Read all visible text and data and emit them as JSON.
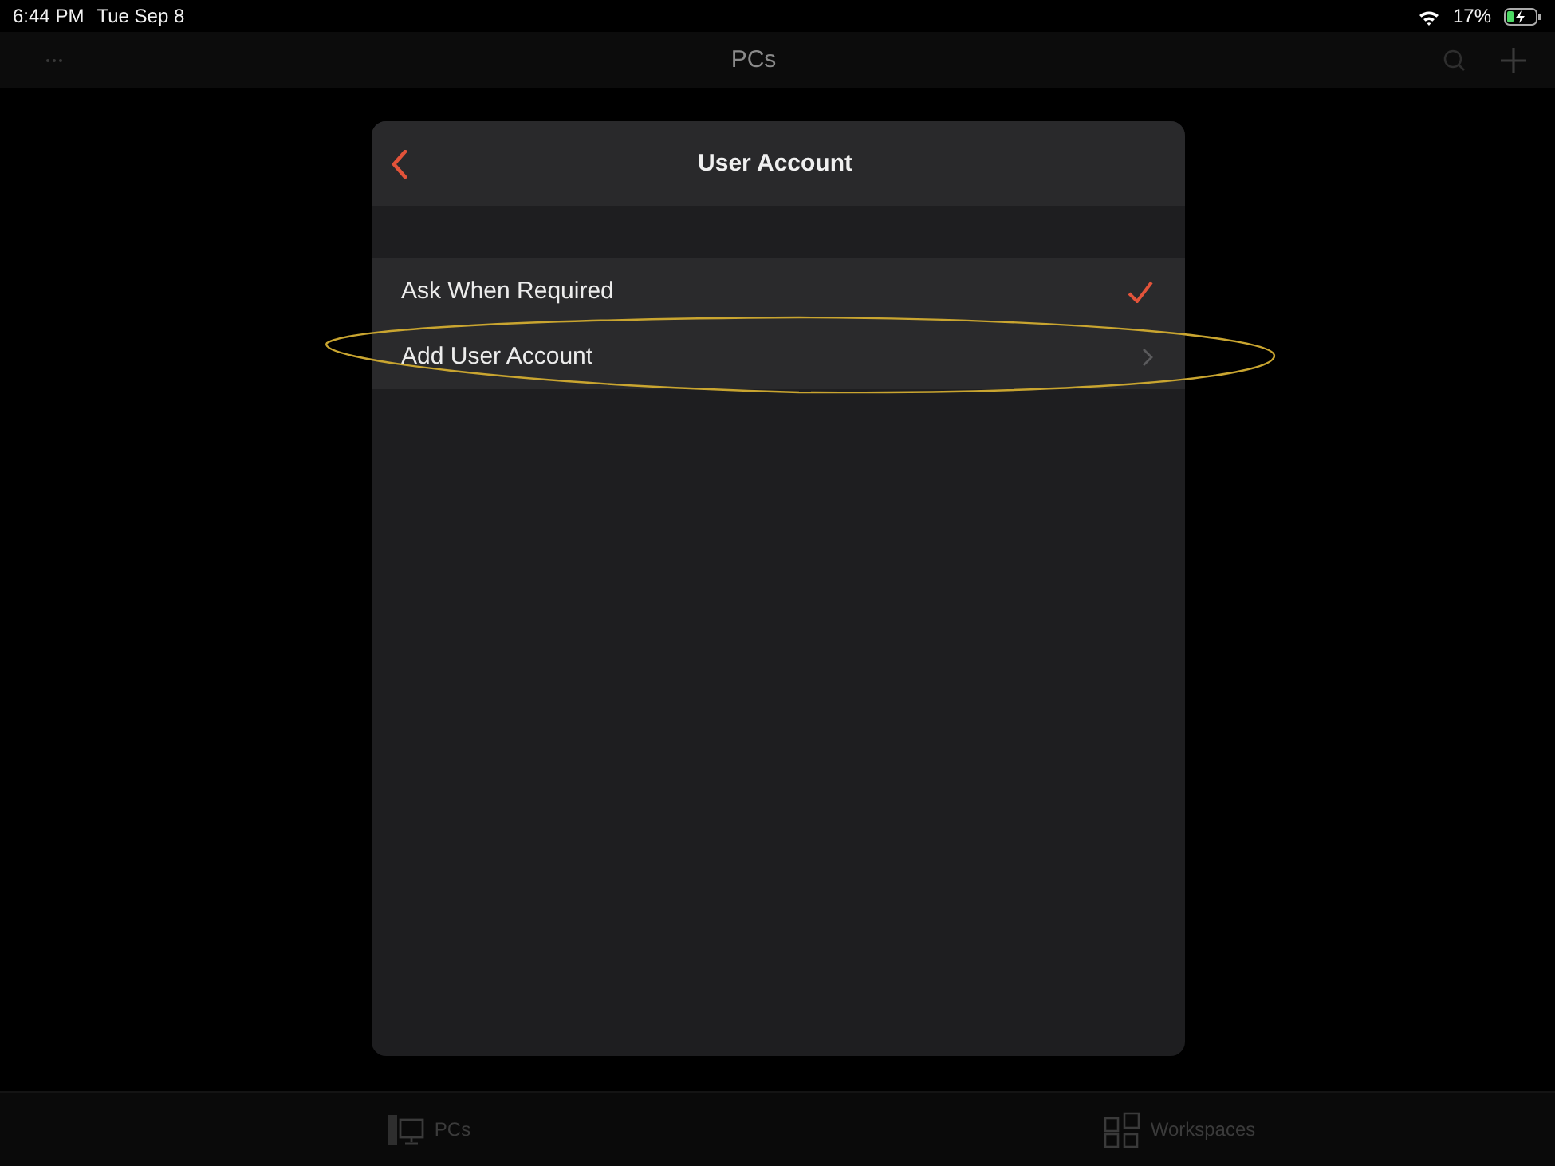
{
  "status_bar": {
    "time": "6:44 PM",
    "date": "Tue Sep 8",
    "battery": "17%",
    "charging": true
  },
  "nav_bar": {
    "title": "PCs"
  },
  "dialog": {
    "title": "User Account",
    "rows": [
      {
        "label": "Ask When Required",
        "kind": "option",
        "selected": true,
        "circled": false
      },
      {
        "label": "Add User Account",
        "kind": "link",
        "selected": false,
        "circled": true
      }
    ]
  },
  "tab_bar": [
    {
      "label": "PCs",
      "kind": "pcs"
    },
    {
      "label": "Workspaces",
      "kind": "workspaces"
    }
  ]
}
